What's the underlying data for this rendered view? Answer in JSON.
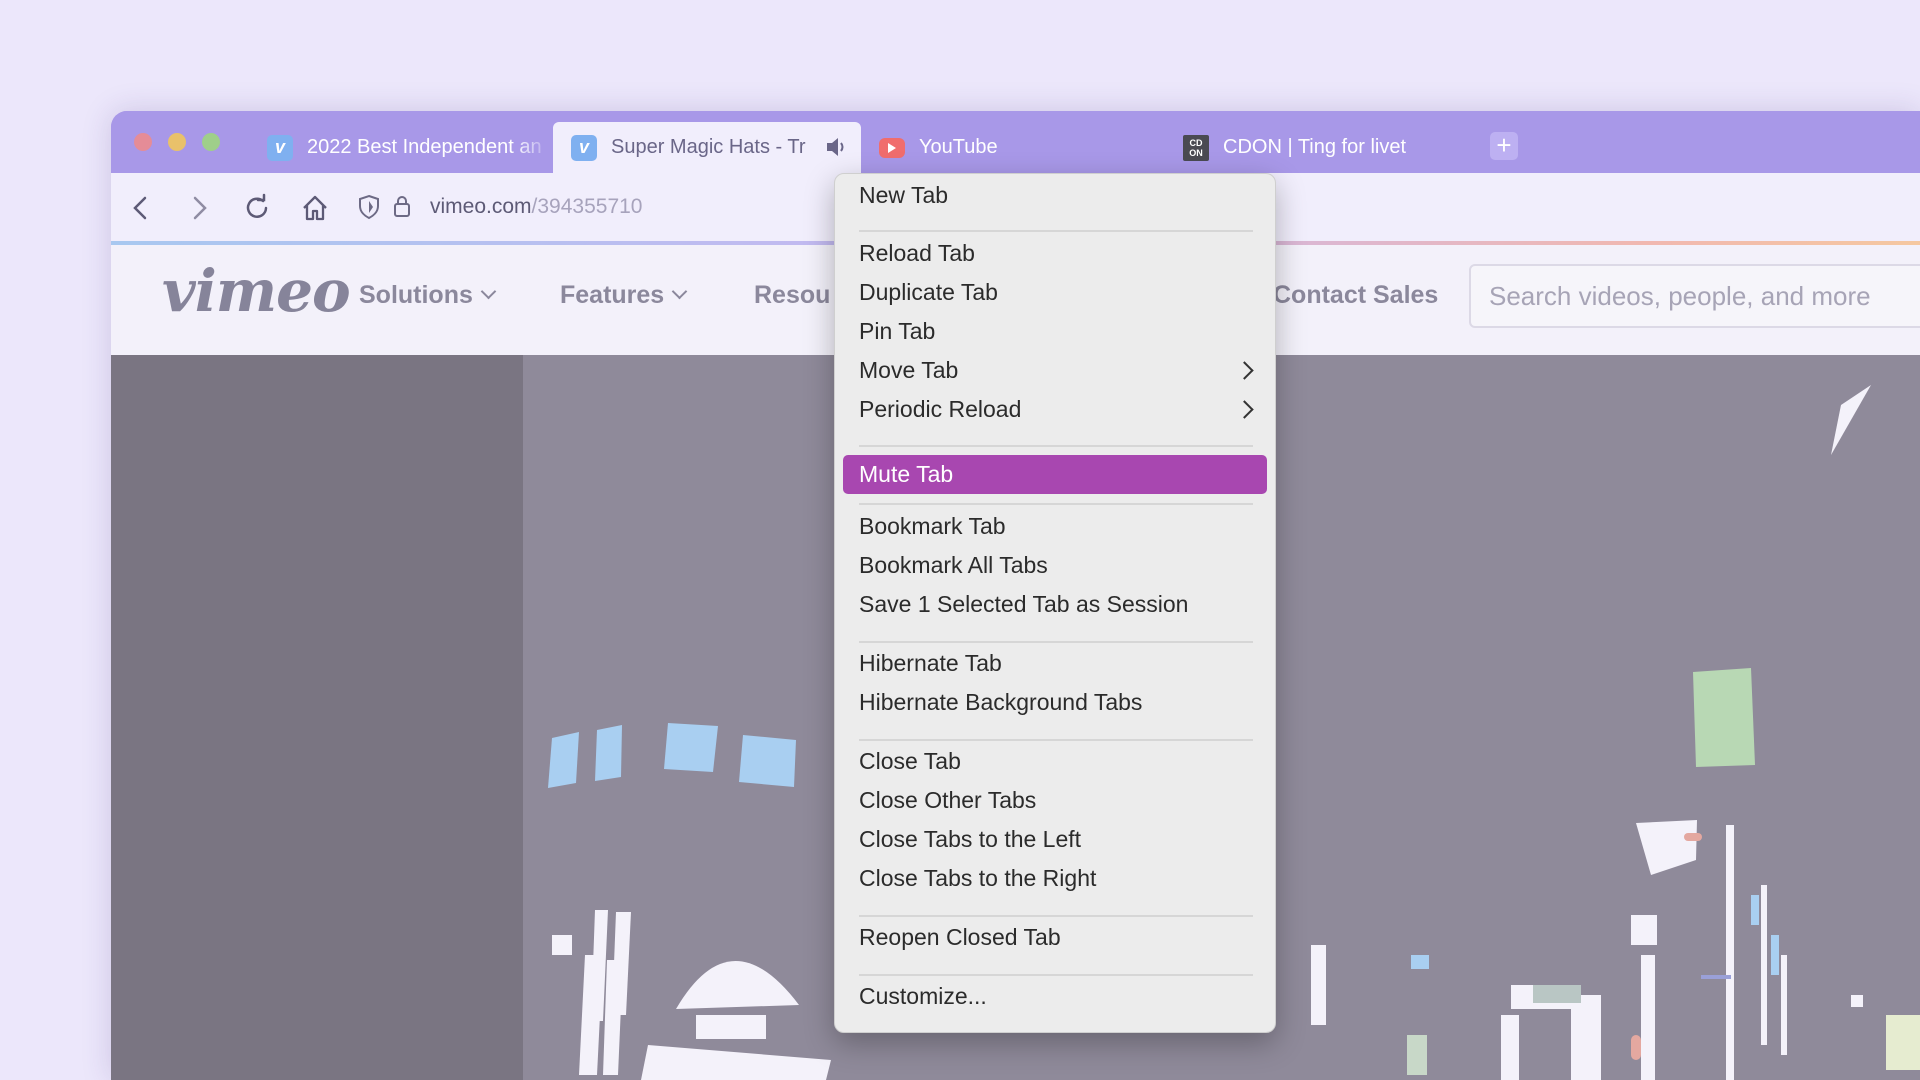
{
  "tabs": [
    {
      "title": "2022 Best Independent an",
      "favicon": "vimeo-icon"
    },
    {
      "title": "Super Magic Hats - Tr",
      "favicon": "vimeo-icon",
      "active": true,
      "audio": true
    },
    {
      "title": "YouTube",
      "favicon": "youtube-icon"
    },
    {
      "title": "CDON | Ting for livet",
      "favicon": "cdon-icon"
    }
  ],
  "new_tab_symbol": "+",
  "address_bar": {
    "domain": "vimeo.com",
    "path": "/394355710"
  },
  "site": {
    "logo": "vimeo",
    "nav": [
      "Solutions",
      "Features",
      "Resou"
    ],
    "contact": "Contact Sales",
    "search_placeholder": "Search videos, people, and more"
  },
  "context_menu": {
    "items": [
      "New Tab",
      "Reload Tab",
      "Duplicate Tab",
      "Pin Tab",
      "Move Tab",
      "Periodic Reload",
      "Mute Tab",
      "Bookmark Tab",
      "Bookmark All Tabs",
      "Save 1 Selected Tab as Session",
      "Hibernate Tab",
      "Hibernate Background Tabs",
      "Close Tab",
      "Close Other Tabs",
      "Close Tabs to the Left",
      "Close Tabs to the Right",
      "Reopen Closed Tab",
      "Customize..."
    ],
    "highlighted": "Mute Tab",
    "highlight_color": "#a847b0"
  },
  "colors": {
    "tabbar": "#a898e8",
    "page_background": "#ece7fb",
    "video_background": "#8f8a9a"
  }
}
